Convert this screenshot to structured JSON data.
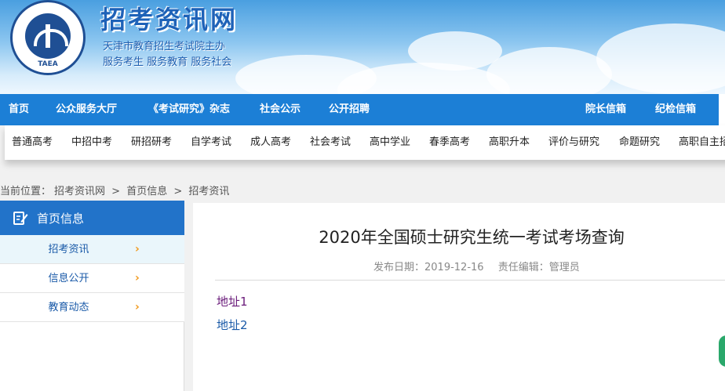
{
  "header": {
    "title": "招考资讯网",
    "subtitle1": "天津市教育招生考试院主办",
    "subtitle2": "服务考生 服务教育 服务社会",
    "logo_text": "TAEA"
  },
  "main_nav": [
    {
      "label": "首页"
    },
    {
      "label": "公众服务大厅"
    },
    {
      "label": "《考试研究》杂志"
    },
    {
      "label": "社会公示"
    },
    {
      "label": "公开招聘"
    },
    {
      "label": "院长信箱"
    },
    {
      "label": "纪检信箱"
    }
  ],
  "sub_nav": [
    {
      "label": "普通高考"
    },
    {
      "label": "中招中考"
    },
    {
      "label": "研招研考"
    },
    {
      "label": "自学考试"
    },
    {
      "label": "成人高考"
    },
    {
      "label": "社会考试"
    },
    {
      "label": "高中学业"
    },
    {
      "label": "春季高考"
    },
    {
      "label": "高职升本"
    },
    {
      "label": "评价与研究"
    },
    {
      "label": "命题研究"
    },
    {
      "label": "高职自主招"
    }
  ],
  "breadcrumb": {
    "prefix": "当前位置：",
    "items": [
      "招考资讯网",
      "首页信息",
      "招考资讯"
    ],
    "separator": ">"
  },
  "sidebar": {
    "heading": "首页信息",
    "items": [
      {
        "label": "招考资讯",
        "chevron": "›"
      },
      {
        "label": "信息公开",
        "chevron": "›"
      },
      {
        "label": "教育动态",
        "chevron": "›"
      }
    ]
  },
  "article": {
    "title": "2020年全国硕士研究生统一考试考场查询",
    "date_label": "发布日期：2019-12-16",
    "editor_label": "责任编辑：管理员",
    "links": [
      "地址1",
      "地址2"
    ]
  },
  "colors": {
    "nav_blue": "#1c7fd6",
    "sidebar_head": "#2273c9",
    "link_visited": "#6a1b7a",
    "link": "#1a5aa8",
    "chevron": "#f19a1e"
  }
}
